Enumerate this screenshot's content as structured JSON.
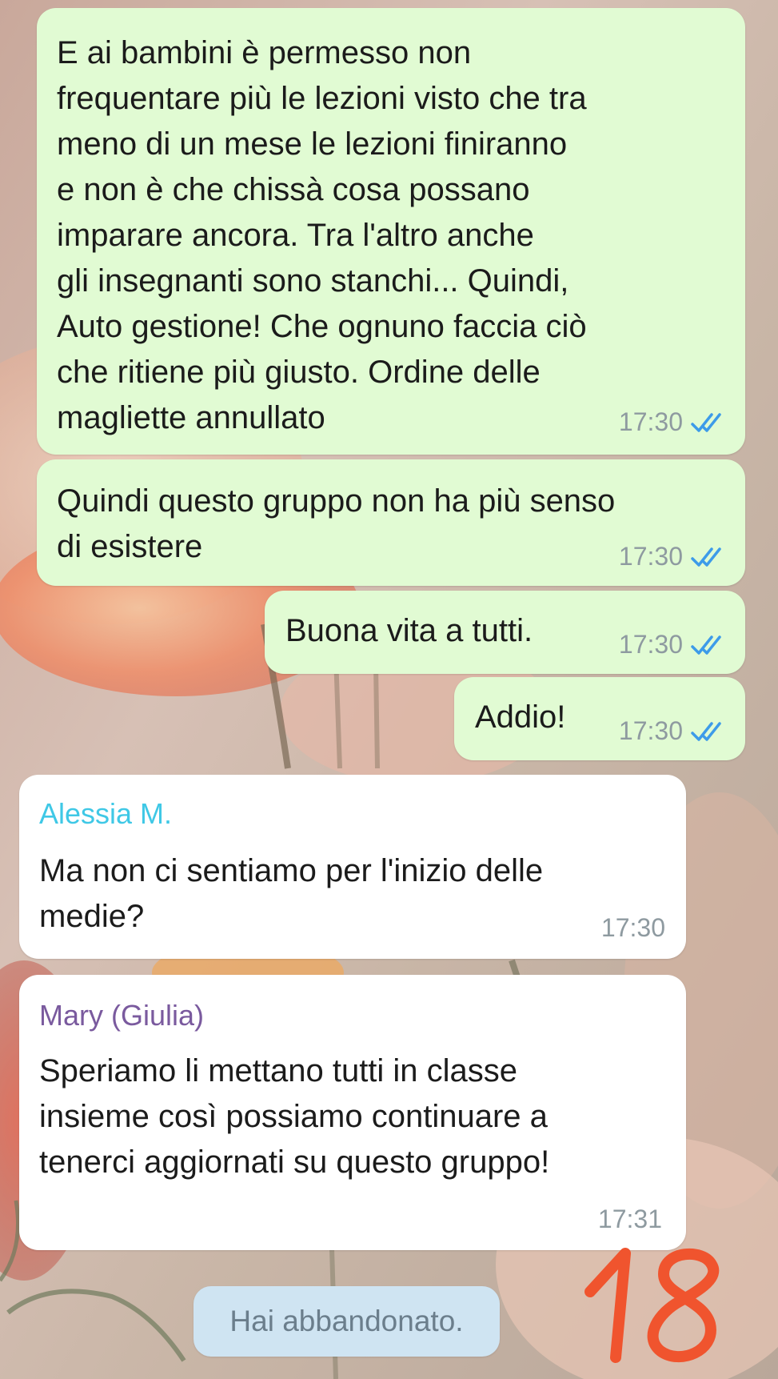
{
  "messages": [
    {
      "direction": "outgoing",
      "text": "E ai bambini è permesso non\nfrequentare più le lezioni visto che tra\nmeno di un mese le lezioni finiranno\ne non è che chissà cosa possano\nimparare ancora. Tra l'altro anche\ngli insegnanti sono stanchi... Quindi,\nAuto gestione! Che ognuno faccia ciò\nche ritiene più giusto. Ordine delle\nmagliette annullato",
      "time": "17:30",
      "status": "read"
    },
    {
      "direction": "outgoing",
      "text": "Quindi questo gruppo non ha più senso\ndi esistere",
      "time": "17:30",
      "status": "read"
    },
    {
      "direction": "outgoing",
      "text": "Buona vita a tutti.",
      "time": "17:30",
      "status": "read"
    },
    {
      "direction": "outgoing",
      "text": "Addio!",
      "time": "17:30",
      "status": "read"
    },
    {
      "direction": "incoming",
      "sender": "Alessia M.",
      "sender_color": "#3fc8e6",
      "text": "Ma non ci sentiamo per l'inizio delle\nmedie?",
      "time": "17:30"
    },
    {
      "direction": "incoming",
      "sender": "Mary (Giulia)",
      "sender_color": "#7a5a9e",
      "text": "Speriamo li mettano tutti in classe\ninsieme così possiamo continuare a\ntenerci aggiornati su questo gruppo!",
      "time": "17:31"
    }
  ],
  "system_message": "Hai abbandonato.",
  "overlay_number": "18",
  "colors": {
    "outgoing_bubble": "#e1fbd3",
    "incoming_bubble": "#ffffff",
    "read_ticks": "#3d9be9",
    "timestamp": "#8e9aa0",
    "system_pill": "#cfe4f2",
    "overlay_number": "#f0542e"
  },
  "icons": {
    "read_status": "double-check-icon"
  }
}
